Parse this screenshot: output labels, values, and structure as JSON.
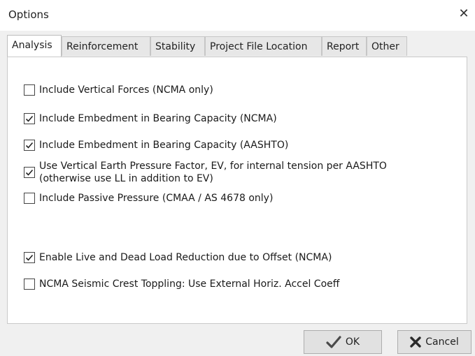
{
  "window": {
    "title": "Options",
    "close_glyph": "✕"
  },
  "tabs": [
    {
      "label": "Analysis",
      "active": true
    },
    {
      "label": "Reinforcement",
      "active": false
    },
    {
      "label": "Stability",
      "active": false
    },
    {
      "label": "Project File Location",
      "active": false
    },
    {
      "label": "Report",
      "active": false
    },
    {
      "label": "Other",
      "active": false
    }
  ],
  "options": [
    {
      "label": "Include Vertical Forces (NCMA only)",
      "checked": false
    },
    {
      "label": "Include Embedment in Bearing Capacity (NCMA)",
      "checked": true
    },
    {
      "label": "Include Embedment in Bearing Capacity (AASHTO)",
      "checked": true
    },
    {
      "label": "Use Vertical Earth Pressure Factor, EV, for internal tension per AASHTO",
      "label2": "(otherwise use LL in addition to EV)",
      "checked": true
    },
    {
      "label": "Include Passive Pressure (CMAA / AS 4678 only)",
      "checked": false
    },
    {
      "label": "Enable Live and Dead Load Reduction due to Offset (NCMA)",
      "checked": true
    },
    {
      "label": "NCMA Seismic Crest Toppling: Use External Horiz. Accel Coeff",
      "checked": false
    }
  ],
  "buttons": {
    "ok_label": "OK",
    "ok_icon": "checkmark-icon",
    "cancel_label": "Cancel",
    "cancel_icon": "x-icon"
  },
  "colors": {
    "ok_check": "#4a4a4a",
    "cancel_x": "#2a2a2a"
  }
}
